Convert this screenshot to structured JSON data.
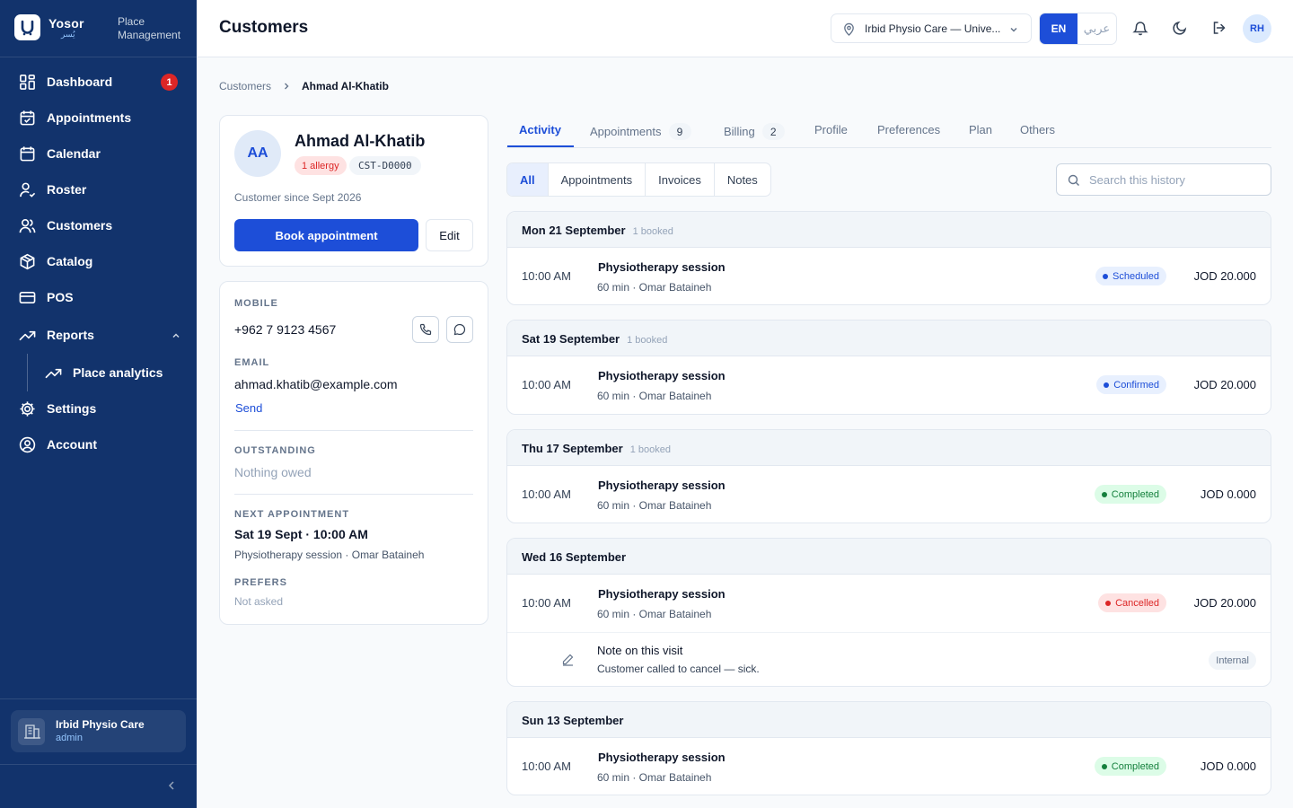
{
  "brand": {
    "name": "Yosor",
    "name_ar": "يُسر",
    "subtitle_line1": "Place",
    "subtitle_line2": "Management"
  },
  "sidebar": {
    "items": [
      {
        "label": "Dashboard",
        "badge": "1",
        "icon": "dashboard-icon"
      },
      {
        "label": "Appointments",
        "icon": "calendar-check-icon"
      },
      {
        "label": "Calendar",
        "icon": "calendar-icon"
      },
      {
        "label": "Roster",
        "icon": "roster-icon"
      },
      {
        "label": "Customers",
        "icon": "users-icon"
      },
      {
        "label": "Catalog",
        "icon": "box-icon"
      },
      {
        "label": "POS",
        "icon": "card-icon"
      },
      {
        "label": "Reports",
        "icon": "trend-icon"
      },
      {
        "label": "Place analytics",
        "icon": "trend-icon"
      },
      {
        "label": "Settings",
        "icon": "gear-icon"
      },
      {
        "label": "Account",
        "icon": "user-circle-icon"
      }
    ],
    "place": {
      "name": "Irbid Physio Care",
      "role": "admin"
    }
  },
  "header": {
    "title": "Customers",
    "place_selector": "Irbid Physio Care — Unive...",
    "lang_en": "EN",
    "lang_ar": "عربي",
    "user_initials": "RH"
  },
  "breadcrumb": {
    "parent": "Customers",
    "current": "Ahmad Al-Khatib"
  },
  "customer": {
    "initials": "AA",
    "name": "Ahmad Al-Khatib",
    "allergy": "1 allergy",
    "code": "CST-D0000",
    "since": "Customer since Sept 2026",
    "book_label": "Book appointment",
    "edit_label": "Edit"
  },
  "details": {
    "mobile_label": "MOBILE",
    "mobile": "+962 7 9123 4567",
    "email_label": "EMAIL",
    "email": "ahmad.khatib@example.com",
    "send_label": "Send",
    "outstanding_label": "OUTSTANDING",
    "outstanding": "Nothing owed",
    "next_label": "NEXT APPOINTMENT",
    "next_when": "Sat 19 Sept · 10:00 AM",
    "next_detail": "Physiotherapy session · Omar Bataineh",
    "prefers_label": "PREFERS",
    "prefers": "Not asked"
  },
  "tabs": [
    {
      "label": "Activity",
      "active": true
    },
    {
      "label": "Appointments",
      "count": "9"
    },
    {
      "label": "Billing",
      "count": "2"
    },
    {
      "label": "Profile"
    },
    {
      "label": "Preferences"
    },
    {
      "label": "Plan"
    },
    {
      "label": "Others"
    }
  ],
  "filters": [
    "All",
    "Appointments",
    "Invoices",
    "Notes"
  ],
  "search": {
    "placeholder": "Search this history"
  },
  "history": [
    {
      "date": "Mon 21 September",
      "count": "1 booked",
      "time": "10:00 AM",
      "service": "Physiotherapy session",
      "meta": "60 min · Omar Bataineh",
      "status": "Scheduled",
      "price": "JOD 20.000"
    },
    {
      "date": "Sat 19 September",
      "count": "1 booked",
      "time": "10:00 AM",
      "service": "Physiotherapy session",
      "meta": "60 min · Omar Bataineh",
      "status": "Confirmed",
      "price": "JOD 20.000"
    },
    {
      "date": "Thu 17 September",
      "count": "1 booked",
      "time": "10:00 AM",
      "service": "Physiotherapy session",
      "meta": "60 min · Omar Bataineh",
      "status": "Completed",
      "price": "JOD 0.000"
    },
    {
      "date": "Wed 16 September",
      "count": "",
      "time": "10:00 AM",
      "service": "Physiotherapy session",
      "meta": "60 min · Omar Bataineh",
      "status": "Cancelled",
      "price": "JOD 20.000",
      "note": {
        "title": "Note on this visit",
        "text": "Customer called to cancel — sick.",
        "tag": "Internal"
      }
    },
    {
      "date": "Sun 13 September",
      "count": "",
      "time": "10:00 AM",
      "service": "Physiotherapy session",
      "meta": "60 min · Omar Bataineh",
      "status": "Completed",
      "price": "JOD 0.000"
    }
  ],
  "colors": {
    "sidebar": "#12336c",
    "accent": "#1d4ed8",
    "danger": "#dc2626",
    "success": "#15803d"
  }
}
